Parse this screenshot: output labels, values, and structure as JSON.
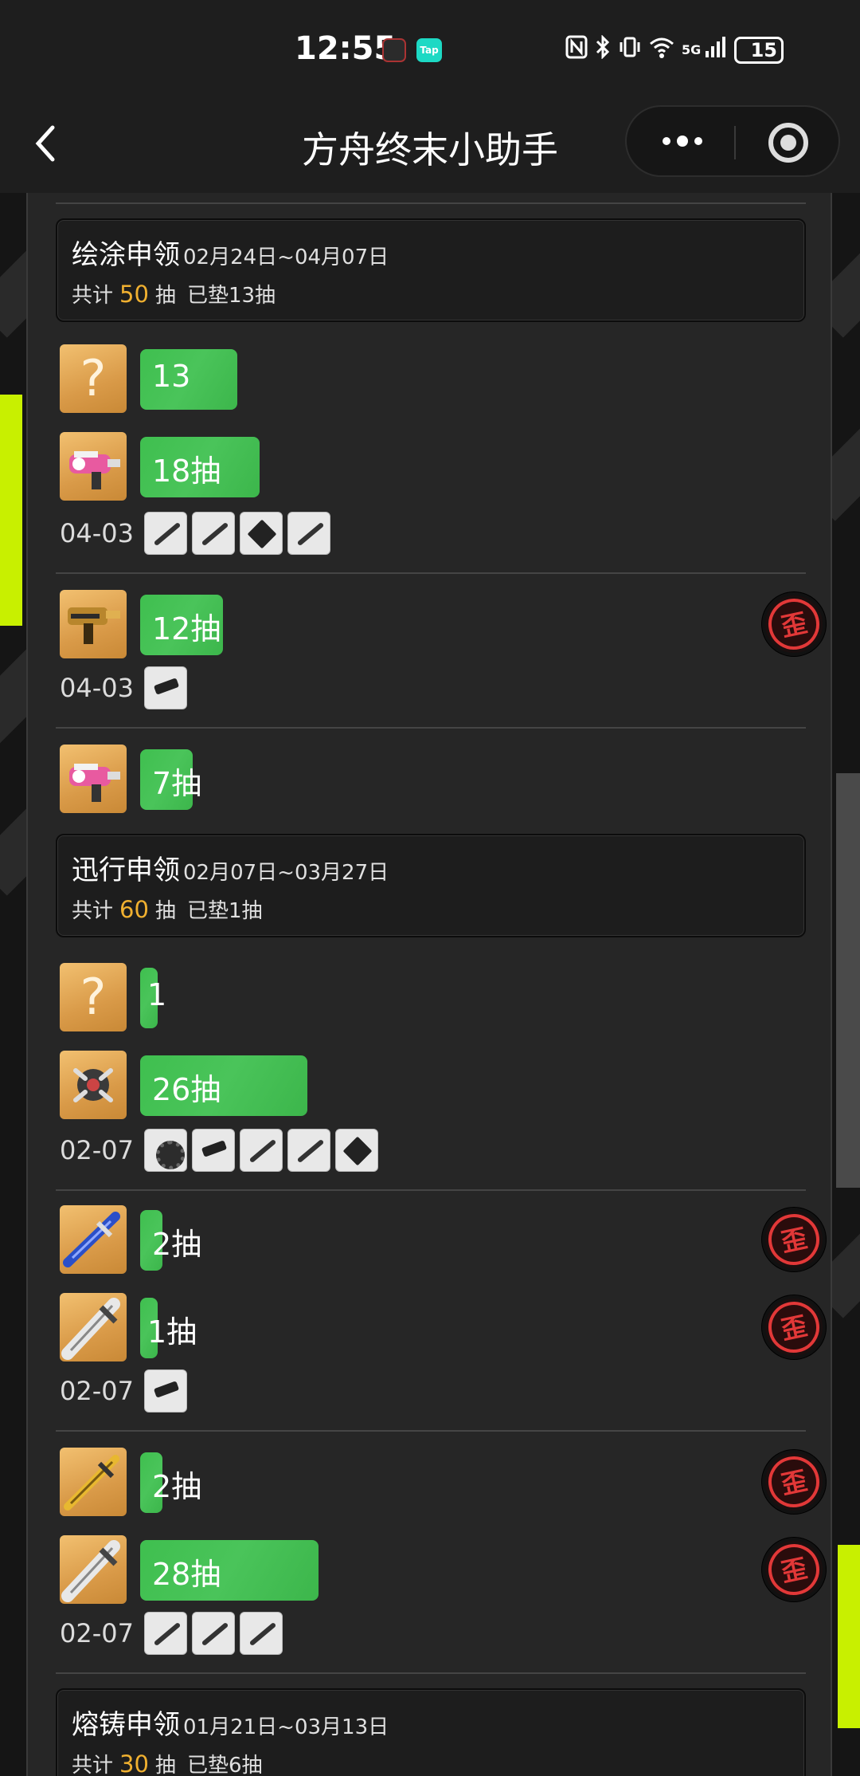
{
  "status_bar": {
    "time": "12:55",
    "app_badge": "Tap",
    "signal_label": "5G",
    "battery": "15"
  },
  "nav": {
    "back_icon": "chevron-left-icon",
    "title": "方舟终末小助手",
    "more_icon": "more-dots-icon",
    "close_icon": "target-icon"
  },
  "banners": [
    {
      "name": "绘涂申领",
      "date": "02月24日~04月07日",
      "total_prefix": "共计",
      "total": "50",
      "total_suffix": "抽",
      "pity": "已垫13抽"
    },
    {
      "name": "迅行申领",
      "date": "02月07日~03月27日",
      "total_prefix": "共计",
      "total": "60",
      "total_suffix": "抽",
      "pity": "已垫1抽"
    },
    {
      "name": "熔铸申领",
      "date": "01月21日~03月13日",
      "total_prefix": "共计",
      "total": "30",
      "total_suffix": "抽",
      "pity": "已垫6抽"
    }
  ],
  "records": [
    {
      "label": "13",
      "pulls": 13,
      "avatar": "unknown",
      "off_banner": false
    },
    {
      "label": "18抽",
      "pulls": 18,
      "avatar": "pink-gun",
      "off_banner": false
    },
    {
      "label": "12抽",
      "pulls": 12,
      "avatar": "gold-gun",
      "off_banner": true
    },
    {
      "label": "7抽",
      "pulls": 7,
      "avatar": "pink-gun",
      "off_banner": false
    },
    {
      "label": "1",
      "pulls": 1,
      "avatar": "unknown",
      "off_banner": false
    },
    {
      "label": "26抽",
      "pulls": 26,
      "avatar": "claw",
      "off_banner": false
    },
    {
      "label": "2抽",
      "pulls": 2,
      "avatar": "blue-sword",
      "off_banner": true
    },
    {
      "label": "1抽",
      "pulls": 1,
      "avatar": "silver-sword",
      "off_banner": true
    },
    {
      "label": "2抽",
      "pulls": 2,
      "avatar": "gold-sword",
      "off_banner": true
    },
    {
      "label": "28抽",
      "pulls": 28,
      "avatar": "silver-sword",
      "off_banner": true
    }
  ],
  "sub_rows": [
    {
      "date": "04-03",
      "thumbs": 4
    },
    {
      "date": "04-03",
      "thumbs": 1
    },
    {
      "date": "02-07",
      "thumbs": 5
    },
    {
      "date": "02-07",
      "thumbs": 1
    },
    {
      "date": "02-07",
      "thumbs": 3
    }
  ],
  "off_banner_badge": "歪",
  "unknown_glyph": "?",
  "colors": {
    "bar": "#3fbf4f",
    "accent_number": "#f0b030",
    "badge": "#e23838",
    "lime": "#c8f000"
  }
}
